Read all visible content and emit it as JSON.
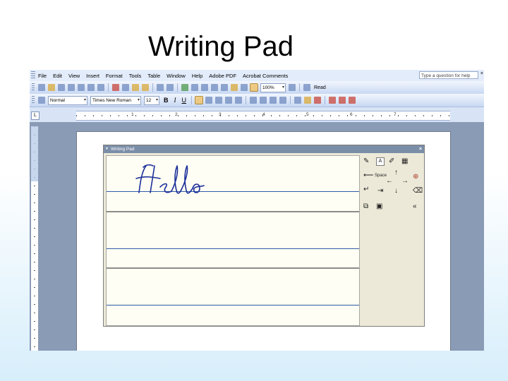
{
  "slide": {
    "title": "Writing Pad"
  },
  "menubar": {
    "items": [
      "File",
      "Edit",
      "View",
      "Insert",
      "Format",
      "Tools",
      "Table",
      "Window",
      "Help",
      "Adobe PDF",
      "Acrobat Comments"
    ],
    "help_placeholder": "Type a question for help"
  },
  "toolbar_standard": {
    "zoom": "100%",
    "read_label": "Read"
  },
  "toolbar_formatting": {
    "style": "Normal",
    "font": "Times New Roman",
    "size": "12",
    "bold": "B",
    "italic": "I",
    "underline": "U"
  },
  "ruler": {
    "corner": "L",
    "marks": [
      "1",
      "2",
      "3",
      "4",
      "5",
      "6",
      "7"
    ]
  },
  "writing_pad": {
    "title": "Writing Pad",
    "handwriting": "Hello",
    "space_label": "Space",
    "collapse_label": "«"
  },
  "colors": {
    "ink": "#1b2f9a",
    "line_blue": "#2f5aa8",
    "app_background": "#8a9bb6",
    "toolbar_blue": "#c8d8f3"
  }
}
